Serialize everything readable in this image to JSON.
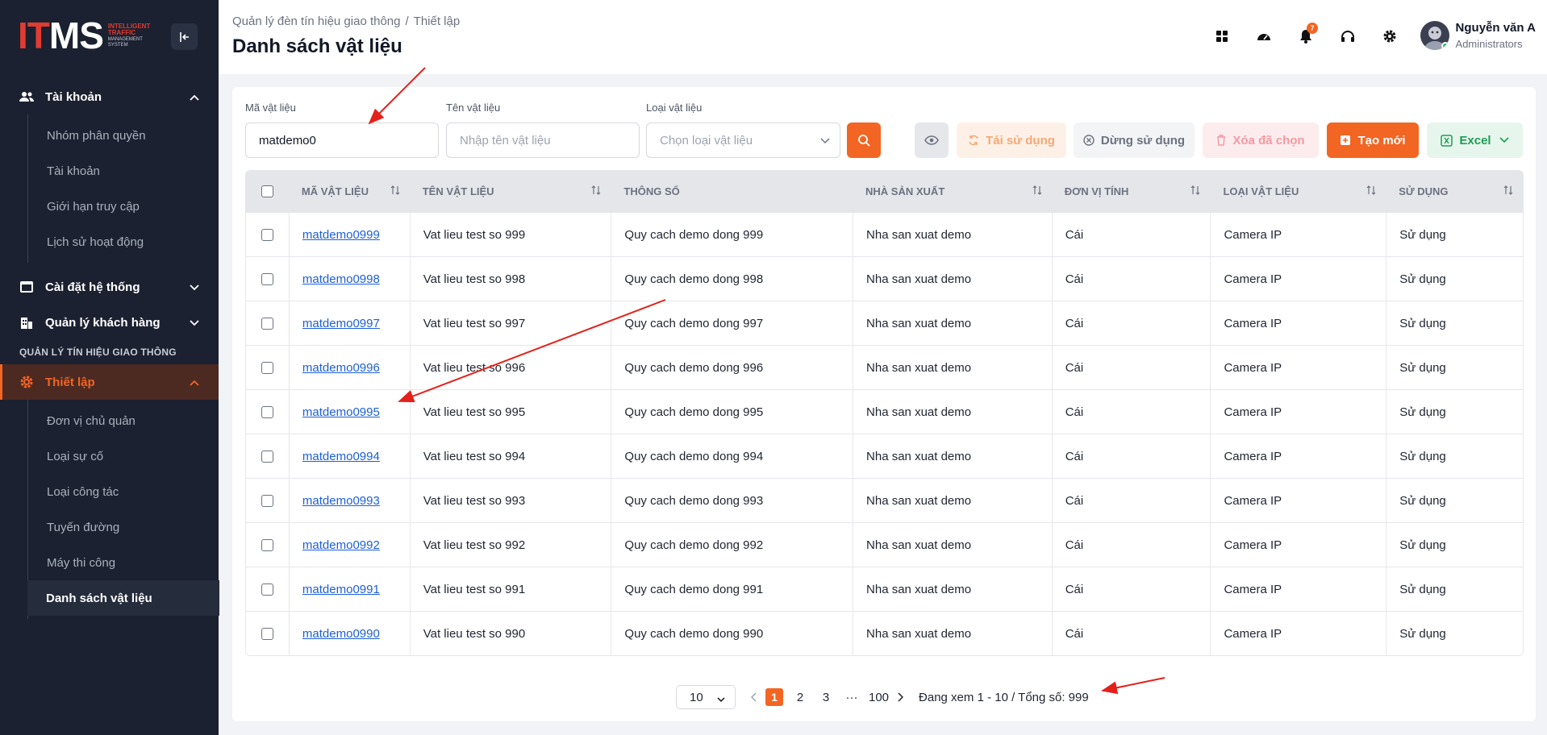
{
  "logo": {
    "mark_a": "IT",
    "mark_b": "MS",
    "line1": "INTELLIGENT",
    "line2": "TRAFFIC",
    "line3": "MANAGEMENT",
    "line4": "SYSTEM"
  },
  "sidebar": {
    "group_account": "Tài khoản",
    "account_items": [
      "Nhóm phân quyền",
      "Tài khoản",
      "Giới hạn truy cập",
      "Lịch sử hoạt động"
    ],
    "group_system": "Cài đặt hệ thống",
    "group_customers": "Quản lý khách hàng",
    "section_label": "QUẢN LÝ TÍN HIỆU GIAO THÔNG",
    "group_setup": "Thiết lập",
    "setup_items": [
      "Đơn vị chủ quản",
      "Loại sự cố",
      "Loại công tác",
      "Tuyến đường",
      "Máy thi công",
      "Danh sách vật liệu"
    ]
  },
  "header": {
    "breadcrumb_root": "Quản lý đèn tín hiệu giao thông",
    "breadcrumb_sep": "/",
    "breadcrumb_current": "Thiết lập",
    "title": "Danh sách vật liệu",
    "notification_count": "7",
    "user_name": "Nguyễn văn A",
    "user_role": "Administrators"
  },
  "filters": {
    "code_label": "Mã vật liệu",
    "code_value": "matdemo0",
    "name_label": "Tên vật liệu",
    "name_placeholder": "Nhập tên vật liệu",
    "type_label": "Loại vật liệu",
    "type_placeholder": "Chọn loại vật liệu"
  },
  "toolbar": {
    "reuse_label": "Tái sử dụng",
    "stop_label": "Dừng sử dụng",
    "delete_label": "Xóa đã chọn",
    "create_label": "Tạo mới",
    "excel_label": "Excel"
  },
  "colors": {
    "accent": "#f26522",
    "sidebar_bg": "#1b2130",
    "link": "#1d5fd8",
    "excel_bg": "#e6f6ec",
    "excel_fg": "#1f9d55"
  },
  "table": {
    "headers": [
      "MÃ VẬT LIỆU",
      "TÊN VẬT LIỆU",
      "THÔNG SỐ",
      "NHÀ SẢN XUẤT",
      "ĐƠN VỊ TÍNH",
      "LOẠI VẬT LIỆU",
      "SỬ DỤNG"
    ],
    "rows": [
      {
        "code": "matdemo0999",
        "name": "Vat lieu test so 999",
        "spec": "Quy cach demo dong 999",
        "maker": "Nha san xuat demo",
        "unit": "Cái",
        "type": "Camera IP",
        "usage": "Sử dụng"
      },
      {
        "code": "matdemo0998",
        "name": "Vat lieu test so 998",
        "spec": "Quy cach demo dong 998",
        "maker": "Nha san xuat demo",
        "unit": "Cái",
        "type": "Camera IP",
        "usage": "Sử dụng"
      },
      {
        "code": "matdemo0997",
        "name": "Vat lieu test so 997",
        "spec": "Quy cach demo dong 997",
        "maker": "Nha san xuat demo",
        "unit": "Cái",
        "type": "Camera IP",
        "usage": "Sử dụng"
      },
      {
        "code": "matdemo0996",
        "name": "Vat lieu test so 996",
        "spec": "Quy cach demo dong 996",
        "maker": "Nha san xuat demo",
        "unit": "Cái",
        "type": "Camera IP",
        "usage": "Sử dụng"
      },
      {
        "code": "matdemo0995",
        "name": "Vat lieu test so 995",
        "spec": "Quy cach demo dong 995",
        "maker": "Nha san xuat demo",
        "unit": "Cái",
        "type": "Camera IP",
        "usage": "Sử dụng"
      },
      {
        "code": "matdemo0994",
        "name": "Vat lieu test so 994",
        "spec": "Quy cach demo dong 994",
        "maker": "Nha san xuat demo",
        "unit": "Cái",
        "type": "Camera IP",
        "usage": "Sử dụng"
      },
      {
        "code": "matdemo0993",
        "name": "Vat lieu test so 993",
        "spec": "Quy cach demo dong 993",
        "maker": "Nha san xuat demo",
        "unit": "Cái",
        "type": "Camera IP",
        "usage": "Sử dụng"
      },
      {
        "code": "matdemo0992",
        "name": "Vat lieu test so 992",
        "spec": "Quy cach demo dong 992",
        "maker": "Nha san xuat demo",
        "unit": "Cái",
        "type": "Camera IP",
        "usage": "Sử dụng"
      },
      {
        "code": "matdemo0991",
        "name": "Vat lieu test so 991",
        "spec": "Quy cach demo dong 991",
        "maker": "Nha san xuat demo",
        "unit": "Cái",
        "type": "Camera IP",
        "usage": "Sử dụng"
      },
      {
        "code": "matdemo0990",
        "name": "Vat lieu test so 990",
        "spec": "Quy cach demo dong 990",
        "maker": "Nha san xuat demo",
        "unit": "Cái",
        "type": "Camera IP",
        "usage": "Sử dụng"
      }
    ]
  },
  "pagination": {
    "page_size": "10",
    "pages": [
      "1",
      "2",
      "3"
    ],
    "ellipsis": "···",
    "last_page": "100",
    "info": "Đang xem 1 - 10 / Tổng số: 999"
  }
}
